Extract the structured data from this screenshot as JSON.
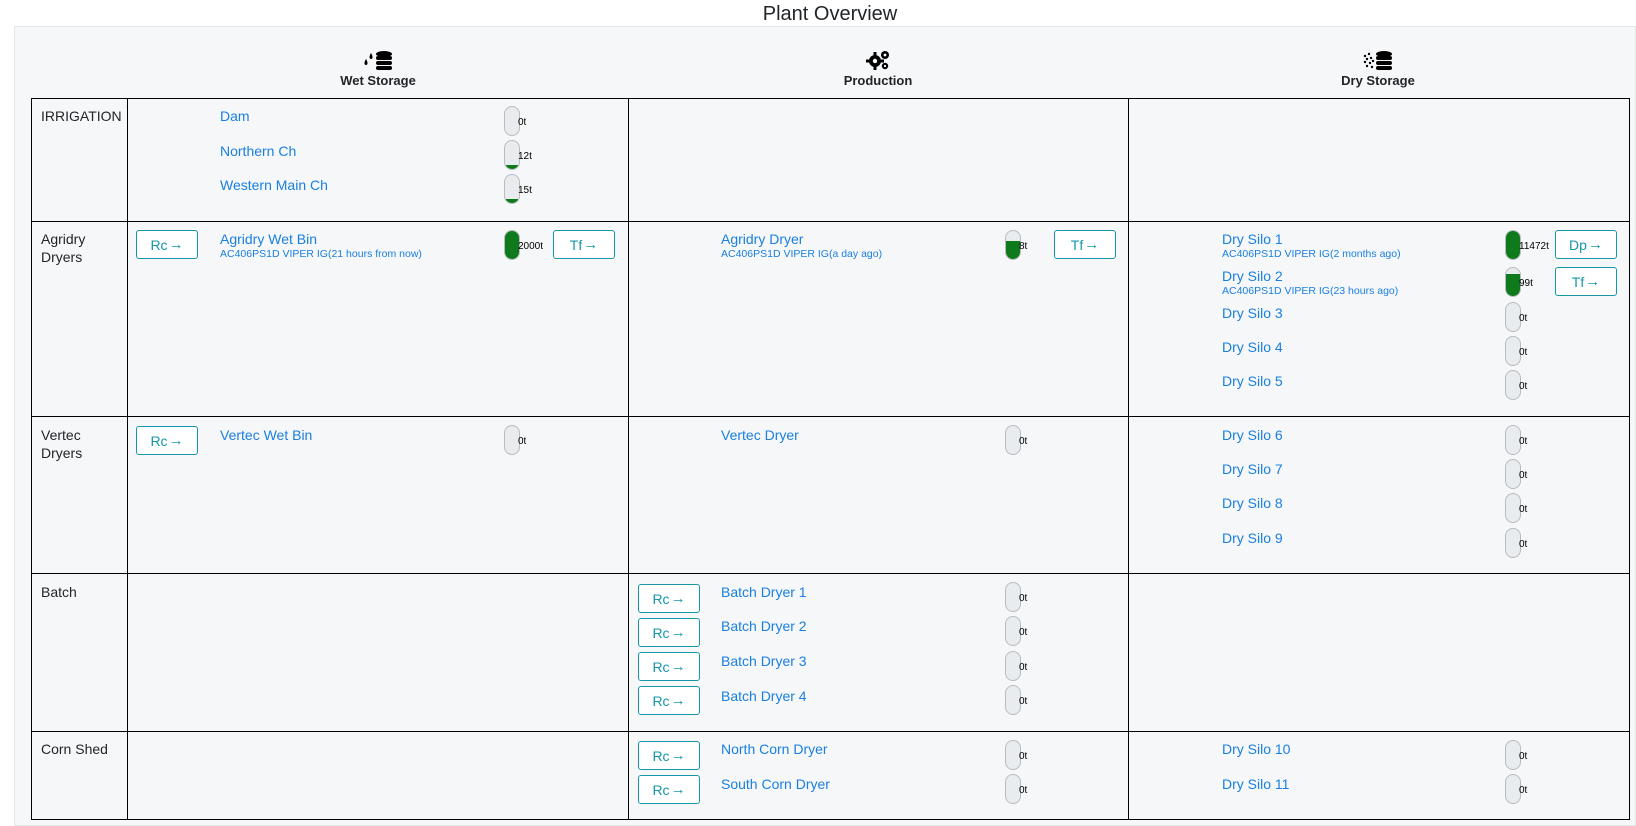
{
  "page": {
    "title": "Plant Overview"
  },
  "columns": [
    {
      "label": "Wet Storage",
      "icon": "wet-storage-icon"
    },
    {
      "label": "Production",
      "icon": "production-gears-icon"
    },
    {
      "label": "Dry Storage",
      "icon": "dry-storage-icon"
    }
  ],
  "rows": [
    {
      "label": "IRRIGATION"
    },
    {
      "label": "Agridry Dryers"
    },
    {
      "label": "Vertec Dryers"
    },
    {
      "label": "Batch"
    },
    {
      "label": "Corn Shed"
    }
  ],
  "buttons": {
    "receive": "Rc",
    "transfer": "Tf",
    "dispatch": "Dp"
  },
  "colors": {
    "link": "#1a7fe0",
    "button": "#1597a9",
    "fill": "#0f7a1c"
  },
  "units": [
    {
      "id": "dam",
      "name": "Dam",
      "qty": "0t",
      "level": 0
    },
    {
      "id": "northern-ch",
      "name": "Northern Ch",
      "qty": "12t",
      "level": 0.15
    },
    {
      "id": "western-main-ch",
      "name": "Western Main Ch",
      "qty": "15t",
      "level": 0.15
    },
    {
      "id": "agridry-wet-bin",
      "name": "Agridry Wet Bin",
      "sub": "AC406PS1D VIPER IG(21 hours from now)",
      "qty": "2000t",
      "level": 1
    },
    {
      "id": "agridry-dryer",
      "name": "Agridry Dryer",
      "sub": "AC406PS1D VIPER IG(a day ago)",
      "qty": "8t",
      "level": 0.65
    },
    {
      "id": "dry-silo-1",
      "name": "Dry Silo 1",
      "sub": "AC406PS1D VIPER IG(2 months ago)",
      "qty": "11472t",
      "level": 1
    },
    {
      "id": "dry-silo-2",
      "name": "Dry Silo 2",
      "sub": "AC406PS1D VIPER IG(23 hours ago)",
      "qty": "99t",
      "level": 0.8
    },
    {
      "id": "dry-silo-3",
      "name": "Dry Silo 3",
      "qty": "0t",
      "level": 0
    },
    {
      "id": "dry-silo-4",
      "name": "Dry Silo 4",
      "qty": "0t",
      "level": 0
    },
    {
      "id": "dry-silo-5",
      "name": "Dry Silo 5",
      "qty": "0t",
      "level": 0
    },
    {
      "id": "vertec-wet-bin",
      "name": "Vertec Wet Bin",
      "qty": "0t",
      "level": 0
    },
    {
      "id": "vertec-dryer",
      "name": "Vertec Dryer",
      "qty": "0t",
      "level": 0
    },
    {
      "id": "dry-silo-6",
      "name": "Dry Silo 6",
      "qty": "0t",
      "level": 0
    },
    {
      "id": "dry-silo-7",
      "name": "Dry Silo 7",
      "qty": "0t",
      "level": 0
    },
    {
      "id": "dry-silo-8",
      "name": "Dry Silo 8",
      "qty": "0t",
      "level": 0
    },
    {
      "id": "dry-silo-9",
      "name": "Dry Silo 9",
      "qty": "0t",
      "level": 0
    },
    {
      "id": "batch-dryer-1",
      "name": "Batch Dryer 1",
      "qty": "0t",
      "level": 0
    },
    {
      "id": "batch-dryer-2",
      "name": "Batch Dryer 2",
      "qty": "0t",
      "level": 0
    },
    {
      "id": "batch-dryer-3",
      "name": "Batch Dryer 3",
      "qty": "0t",
      "level": 0
    },
    {
      "id": "batch-dryer-4",
      "name": "Batch Dryer 4",
      "qty": "0t",
      "level": 0
    },
    {
      "id": "north-corn-dryer",
      "name": "North Corn Dryer",
      "qty": "0t",
      "level": 0
    },
    {
      "id": "south-corn-dryer",
      "name": "South Corn Dryer",
      "qty": "0t",
      "level": 0
    },
    {
      "id": "dry-silo-10",
      "name": "Dry Silo 10",
      "qty": "0t",
      "level": 0
    },
    {
      "id": "dry-silo-11",
      "name": "Dry Silo 11",
      "qty": "0t",
      "level": 0
    }
  ]
}
